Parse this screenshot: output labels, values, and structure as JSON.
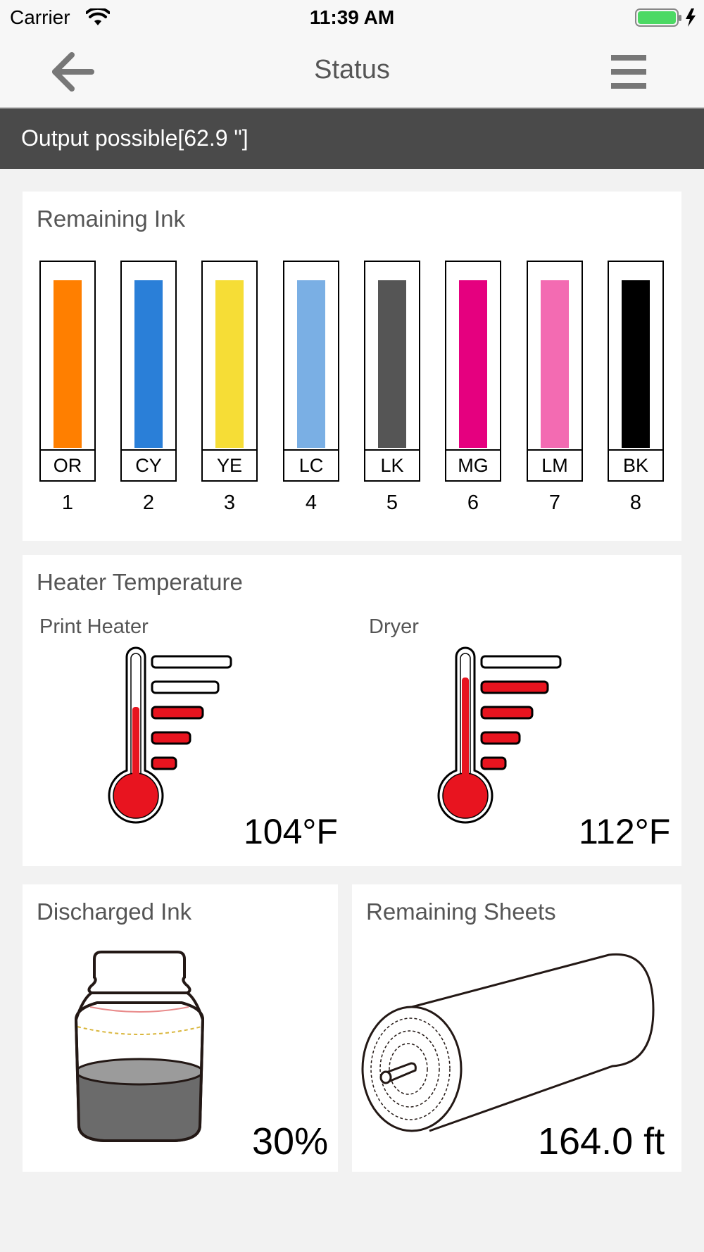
{
  "status_bar": {
    "carrier": "Carrier",
    "time": "11:39 AM"
  },
  "nav": {
    "title": "Status"
  },
  "banner": {
    "text": "Output possible[62.9 \"]"
  },
  "remaining_ink": {
    "title": "Remaining Ink",
    "cartridges": [
      {
        "code": "OR",
        "number": "1",
        "color": "#ff7f00",
        "level": 1.0
      },
      {
        "code": "CY",
        "number": "2",
        "color": "#2a7fd8",
        "level": 1.0
      },
      {
        "code": "YE",
        "number": "3",
        "color": "#f6dd36",
        "level": 1.0
      },
      {
        "code": "LC",
        "number": "4",
        "color": "#7aafe4",
        "level": 1.0
      },
      {
        "code": "LK",
        "number": "5",
        "color": "#555555",
        "level": 1.0
      },
      {
        "code": "MG",
        "number": "6",
        "color": "#e5007f",
        "level": 1.0
      },
      {
        "code": "LM",
        "number": "7",
        "color": "#f36bb2",
        "level": 1.0
      },
      {
        "code": "BK",
        "number": "8",
        "color": "#000000",
        "level": 1.0
      }
    ]
  },
  "heater": {
    "title": "Heater Temperature",
    "print_heater": {
      "label": "Print Heater",
      "value": "104°F",
      "bars_lit": 3,
      "fill_fraction": 0.6
    },
    "dryer": {
      "label": "Dryer",
      "value": "112°F",
      "bars_lit": 4,
      "fill_fraction": 0.82
    },
    "red_color": "#e8141f"
  },
  "discharged_ink": {
    "title": "Discharged Ink",
    "value": "30%",
    "level_fraction": 0.3
  },
  "remaining_sheets": {
    "title": "Remaining Sheets",
    "value": "164.0 ft"
  }
}
